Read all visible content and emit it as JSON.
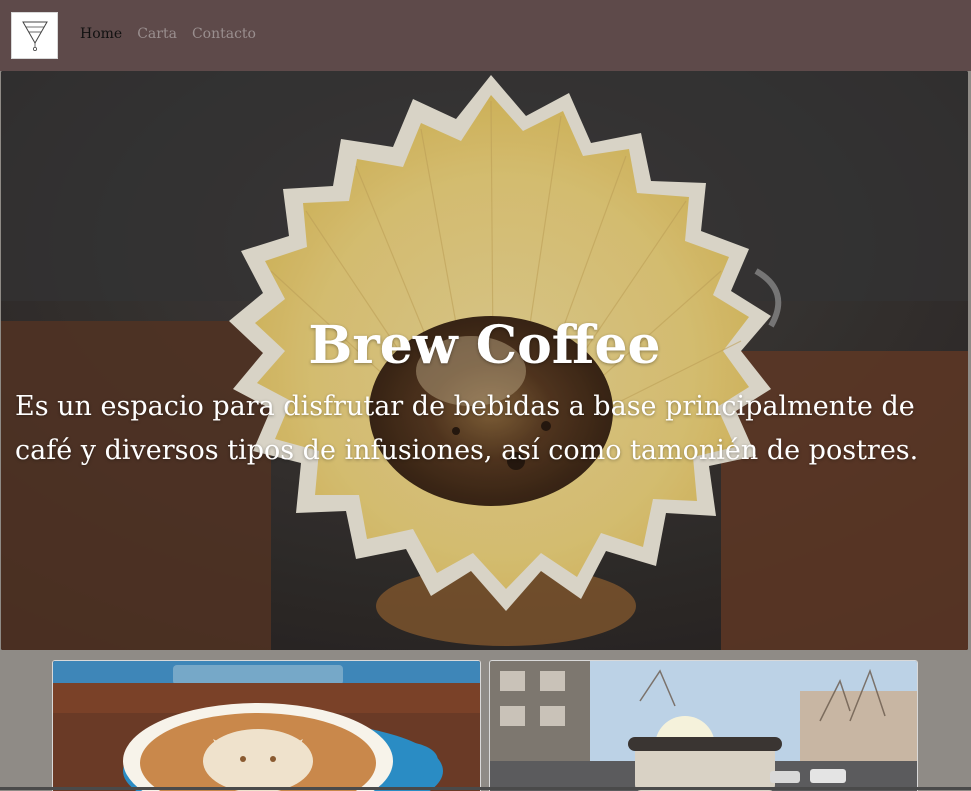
{
  "nav": {
    "logo_icon": "brew-triangle-logo-icon",
    "links": [
      {
        "label": "Home",
        "active": true
      },
      {
        "label": "Carta",
        "active": false
      },
      {
        "label": "Contacto",
        "active": false
      }
    ]
  },
  "hero": {
    "title": "Brew Coffee",
    "description": "Es un espacio para disfrutar de bebidas a base principalmente de café y diversos tipos de infusiones, así como tamonién de postres.",
    "image_subject": "pour-over coffee filter"
  },
  "gallery": {
    "images": [
      {
        "subject": "latte art cat in blue cup"
      },
      {
        "subject": "takeaway coffee cup on sunny street"
      }
    ]
  },
  "colors": {
    "navbar": "#5e4a4a",
    "page_background": "#8f8b86",
    "nav_active": "#111111",
    "nav_inactive": "#9a8f8f",
    "hero_text": "#ffffff"
  }
}
